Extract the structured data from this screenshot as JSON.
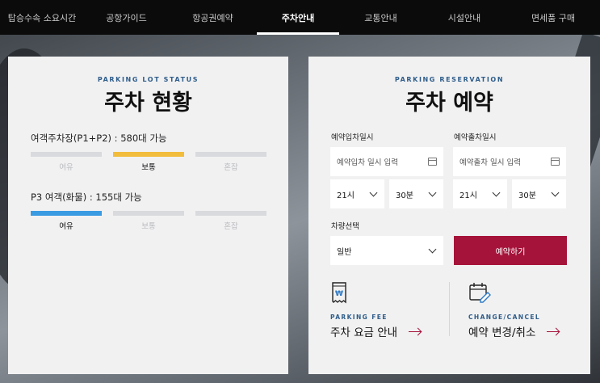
{
  "nav": {
    "items": [
      {
        "label": "탑승수속 소요시간",
        "active": false
      },
      {
        "label": "공항가이드",
        "active": false
      },
      {
        "label": "항공권예약",
        "active": false
      },
      {
        "label": "주차안내",
        "active": true
      },
      {
        "label": "교통안내",
        "active": false
      },
      {
        "label": "시설안내",
        "active": false
      },
      {
        "label": "면세품 구매",
        "active": false
      }
    ]
  },
  "status": {
    "eyebrow": "PARKING LOT STATUS",
    "title": "주차 현황",
    "lots": [
      {
        "name": "여객주차장(P1+P2) : 580대 가능",
        "levels": [
          "여유",
          "보통",
          "혼잡"
        ],
        "current": "보통",
        "current_color": "#f2bd3c"
      },
      {
        "name": "P3 여객(화물) : 155대 가능",
        "levels": [
          "여유",
          "보통",
          "혼잡"
        ],
        "current": "여유",
        "current_color": "#3a9be3"
      }
    ]
  },
  "reservation": {
    "eyebrow": "PARKING RESERVATION",
    "title": "주차 예약",
    "entry": {
      "label": "예약입차일시",
      "placeholder": "예약입차 일시 입력",
      "hour": "21시",
      "minute": "30분"
    },
    "exit": {
      "label": "예약출차일시",
      "placeholder": "예약출차 일시 입력",
      "hour": "21시",
      "minute": "30분"
    },
    "vehicle": {
      "label": "차량선택",
      "value": "일반"
    },
    "submit_label": "예약하기",
    "links": [
      {
        "eyebrow": "PARKING FEE",
        "title": "주차 요금 안내",
        "icon": "receipt-won-icon"
      },
      {
        "eyebrow": "CHANGE/CANCEL",
        "title": "예약 변경/취소",
        "icon": "calendar-edit-icon"
      }
    ]
  },
  "colors": {
    "accent": "#a6133a",
    "eyebrow": "#2f5d8a",
    "nav_bg": "#0b0b0b"
  }
}
